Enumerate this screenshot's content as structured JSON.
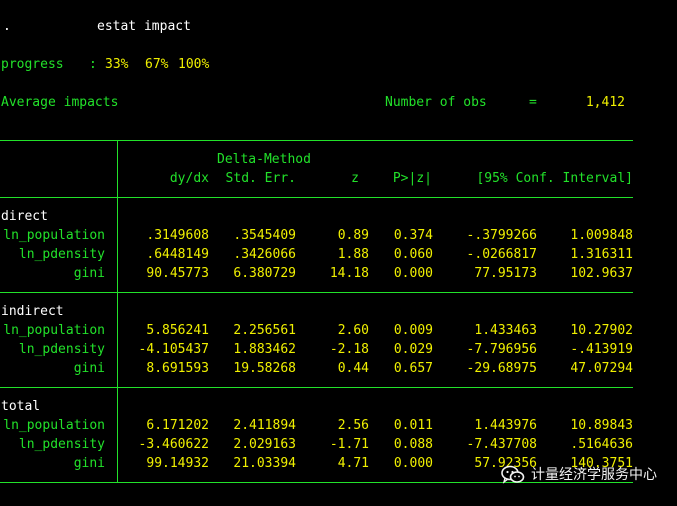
{
  "command": {
    "prompt": ".",
    "text": "estat impact"
  },
  "progress": {
    "label": "progress",
    "colon": ":",
    "steps": [
      "33%",
      "67%",
      "100%"
    ]
  },
  "summary": {
    "title": "Average impacts",
    "obs_label": "Number of obs",
    "equals": "=",
    "obs_value": "1,412"
  },
  "table": {
    "header": {
      "method": "Delta-Method",
      "dydx": "dy/dx",
      "stderr": "Std. Err.",
      "z": "z",
      "p": "P>|z|",
      "ci": "[95% Conf. Interval]"
    },
    "groups": [
      {
        "name": "direct",
        "rows": [
          {
            "var": "ln_population",
            "dydx": ".3149608",
            "se": ".3545409",
            "z": "0.89",
            "p": "0.374",
            "lo": "-.3799266",
            "hi": "1.009848"
          },
          {
            "var": "ln_pdensity",
            "dydx": ".6448149",
            "se": ".3426066",
            "z": "1.88",
            "p": "0.060",
            "lo": "-.0266817",
            "hi": "1.316311"
          },
          {
            "var": "gini",
            "dydx": "90.45773",
            "se": "6.380729",
            "z": "14.18",
            "p": "0.000",
            "lo": "77.95173",
            "hi": "102.9637"
          }
        ]
      },
      {
        "name": "indirect",
        "rows": [
          {
            "var": "ln_population",
            "dydx": "5.856241",
            "se": "2.256561",
            "z": "2.60",
            "p": "0.009",
            "lo": "1.433463",
            "hi": "10.27902"
          },
          {
            "var": "ln_pdensity",
            "dydx": "-4.105437",
            "se": "1.883462",
            "z": "-2.18",
            "p": "0.029",
            "lo": "-7.796956",
            "hi": "-.413919"
          },
          {
            "var": "gini",
            "dydx": "8.691593",
            "se": "19.58268",
            "z": "0.44",
            "p": "0.657",
            "lo": "-29.68975",
            "hi": "47.07294"
          }
        ]
      },
      {
        "name": "total",
        "rows": [
          {
            "var": "ln_population",
            "dydx": "6.171202",
            "se": "2.411894",
            "z": "2.56",
            "p": "0.011",
            "lo": "1.443976",
            "hi": "10.89843"
          },
          {
            "var": "ln_pdensity",
            "dydx": "-3.460622",
            "se": "2.029163",
            "z": "-1.71",
            "p": "0.088",
            "lo": "-7.437708",
            "hi": ".5164636"
          },
          {
            "var": "gini",
            "dydx": "99.14932",
            "se": "21.03394",
            "z": "4.71",
            "p": "0.000",
            "lo": "57.92356",
            "hi": "140.3751"
          }
        ]
      }
    ]
  },
  "watermark": {
    "text": "计量经济学服务中心",
    "icon": "wechat-icon"
  },
  "colors": {
    "background": "#000000",
    "text_white": "#ffffff",
    "text_green": "#22e12a",
    "text_yellow": "#f0f000"
  }
}
